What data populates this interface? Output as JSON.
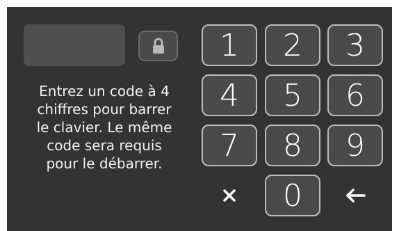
{
  "instructions": "Entrez un code à 4\nchiffres pour barrer\nle clavier. Le même\ncode sera requis\npour le débarrer.",
  "code_display": {
    "value": ""
  },
  "lock_button": {
    "icon": "lock-icon"
  },
  "keypad": {
    "keys": [
      "1",
      "2",
      "3",
      "4",
      "5",
      "6",
      "7",
      "8",
      "9",
      "0"
    ],
    "clear_icon": "close-icon",
    "backspace_icon": "arrow-left-icon"
  },
  "colors": {
    "panel_background": "#333333",
    "key_background": "#4a4a4a",
    "key_border": "#bdbdbd",
    "text": "#ffffff"
  }
}
